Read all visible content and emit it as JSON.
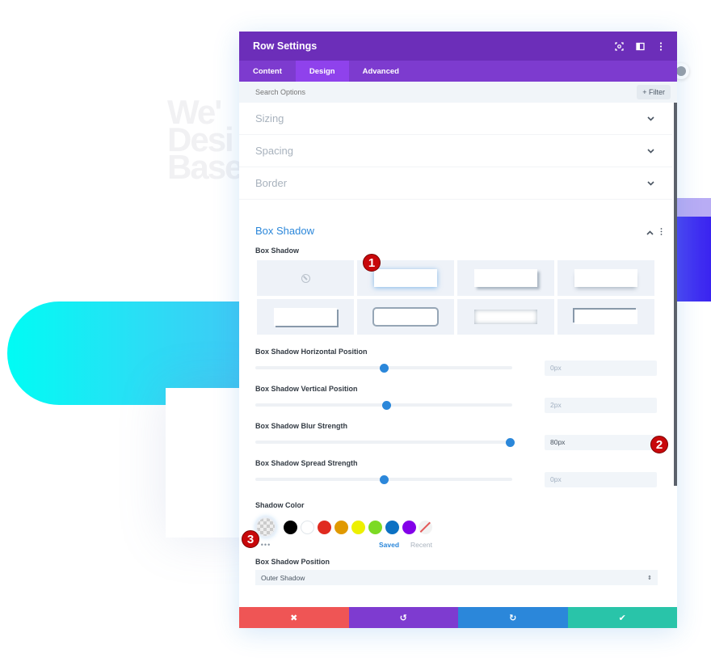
{
  "background": {
    "heading_lines": [
      "We'",
      "Desi",
      "Base"
    ],
    "colors": {
      "pill_start": "#00fcf4",
      "pill_end": "#45c4f5",
      "accent_blue": "#3a23f0",
      "accent_lavender": "#b8acf4"
    }
  },
  "modal": {
    "title": "Row Settings",
    "header_icons": [
      "focus-icon",
      "split-view-icon",
      "more-vertical-icon"
    ],
    "tabs": [
      {
        "label": "Content",
        "active": false
      },
      {
        "label": "Design",
        "active": true
      },
      {
        "label": "Advanced",
        "active": false
      }
    ],
    "search": {
      "placeholder": "Search Options",
      "value": ""
    },
    "filter_label": "+ Filter",
    "sections": [
      {
        "label": "Sizing",
        "expanded": false
      },
      {
        "label": "Spacing",
        "expanded": false
      },
      {
        "label": "Border",
        "expanded": false
      }
    ],
    "box_shadow": {
      "title": "Box Shadow",
      "preset_label": "Box Shadow",
      "presets": [
        "none",
        "preset-1",
        "preset-2",
        "preset-3",
        "preset-4",
        "preset-5",
        "preset-6",
        "preset-7"
      ],
      "selected_preset": 1,
      "sliders": [
        {
          "label": "Box Shadow Horizontal Position",
          "value": "0px",
          "fraction": 0.5,
          "active": false
        },
        {
          "label": "Box Shadow Vertical Position",
          "value": "2px",
          "fraction": 0.51,
          "active": false
        },
        {
          "label": "Box Shadow Blur Strength",
          "value": "80px",
          "fraction": 0.99,
          "active": true
        },
        {
          "label": "Box Shadow Spread Strength",
          "value": "0px",
          "fraction": 0.5,
          "active": false
        }
      ],
      "shadow_color_label": "Shadow Color",
      "swatches": [
        "#000000",
        "#ffffff",
        "#e02b20",
        "#e09900",
        "#edf000",
        "#7cda24",
        "#0c71c3",
        "#8300e9"
      ],
      "color_tabs": {
        "saved": "Saved",
        "recent": "Recent",
        "more": "•••"
      },
      "position_label": "Box Shadow Position",
      "position_value": "Outer Shadow"
    },
    "footer": {
      "cancel": "✖",
      "undo": "↺",
      "redo": "↻",
      "save": "✔"
    },
    "colors": {
      "header": "#6c2eb9",
      "tabs": "#7d3bcf",
      "accent": "#2b87da",
      "cancel": "#ef5555",
      "undo": "#7e3bd0",
      "redo": "#2b87da",
      "save": "#29c4a9"
    }
  },
  "annotations": [
    "1",
    "2",
    "3"
  ]
}
